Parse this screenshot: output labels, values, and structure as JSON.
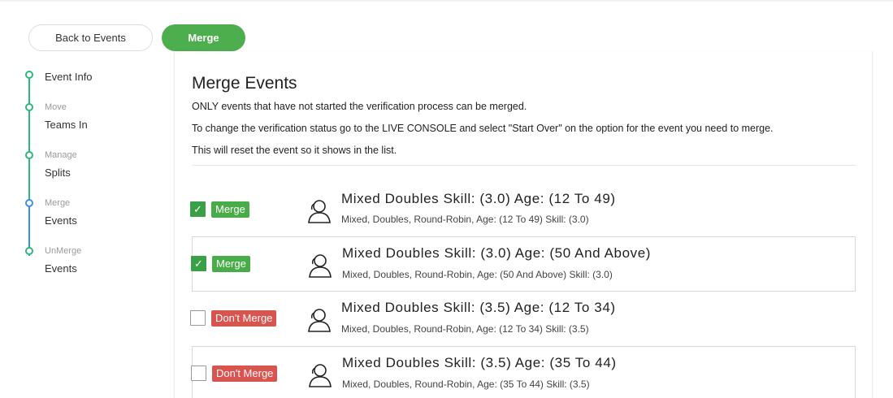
{
  "toolbar": {
    "back_label": "Back to Events",
    "merge_label": "Merge"
  },
  "stepper": [
    {
      "small": "",
      "main": "Event Info",
      "state": "done"
    },
    {
      "small": "Move",
      "main": "Teams In",
      "state": "done"
    },
    {
      "small": "Manage",
      "main": "Splits",
      "state": "done"
    },
    {
      "small": "Merge",
      "main": "Events",
      "state": "current"
    },
    {
      "small": "UnMerge",
      "main": "Events",
      "state": "done"
    }
  ],
  "panel": {
    "title": "Merge Events",
    "notes": [
      "ONLY events that have not started the verification process can be merged.",
      "To change the verification status go to the LIVE CONSOLE and select \"Start Over\" on the option for the event you need to merge.",
      "This will reset the event so it shows in the list."
    ]
  },
  "events": [
    {
      "checked": true,
      "status": "Merge",
      "title": "Mixed Doubles Skill: (3.0) Age: (12 To 49)",
      "subtitle": "Mixed, Doubles, Round-Robin, Age: (12 To 49) Skill: (3.0)"
    },
    {
      "checked": true,
      "status": "Merge",
      "title": "Mixed Doubles Skill: (3.0) Age: (50 And Above)",
      "subtitle": "Mixed, Doubles, Round-Robin, Age: (50 And Above) Skill: (3.0)"
    },
    {
      "checked": false,
      "status": "Don't Merge",
      "title": "Mixed Doubles Skill: (3.5) Age: (12 To 34)",
      "subtitle": "Mixed, Doubles, Round-Robin, Age: (12 To 34) Skill: (3.5)"
    },
    {
      "checked": false,
      "status": "Don't Merge",
      "title": "Mixed Doubles Skill: (3.5) Age: (35 To 44)",
      "subtitle": "Mixed, Doubles, Round-Robin, Age: (35 To 44) Skill: (3.5)"
    }
  ],
  "colors": {
    "accent_green": "#4cae4c",
    "step_green": "#2db87d",
    "step_blue": "#3d8fe0",
    "badge_red": "#d9534f"
  },
  "icons": {
    "checkbox_checked": "check-icon",
    "event": "user-icon"
  }
}
